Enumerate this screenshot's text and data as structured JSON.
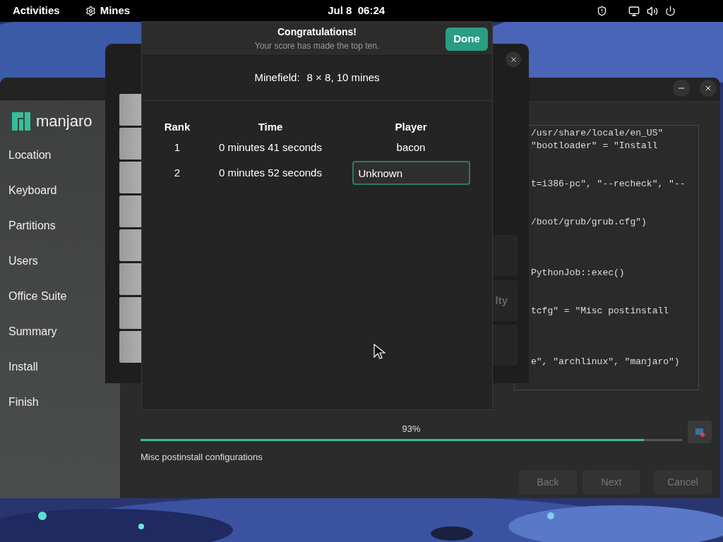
{
  "top_bar": {
    "activities": "Activities",
    "app_name": "Mines",
    "date": "Jul 8",
    "time": "06:24"
  },
  "installer": {
    "logo_text": "manjaro",
    "steps": [
      {
        "label": "Location",
        "selected": false
      },
      {
        "label": "Keyboard",
        "selected": false
      },
      {
        "label": "Partitions",
        "selected": false
      },
      {
        "label": "Users",
        "selected": false
      },
      {
        "label": "Office Suite",
        "selected": false
      },
      {
        "label": "Summary",
        "selected": false
      },
      {
        "label": "Install",
        "selected": false
      },
      {
        "label": "Finish",
        "selected": false
      }
    ],
    "log_lines": [
      "/usr/share/locale/en_US\"",
      "\"bootloader\" = \"Install",
      "t=i386-pc\", \"--recheck\", \"--",
      "/boot/grub/grub.cfg\")",
      "PythonJob::exec()",
      "tcfg\" = \"Misc postinstall",
      "e\", \"archlinux\", \"manjaro\")"
    ],
    "progress": {
      "reading": "93%",
      "level": 0.93
    },
    "status": "Misc postinstall configurations",
    "buttons": [
      {
        "label": "Back",
        "disabled": true
      },
      {
        "label": "Next",
        "disabled": true
      },
      {
        "label": "Cancel",
        "disabled": true
      }
    ]
  },
  "mines_window": {
    "partial_label": "lty"
  },
  "scores_dialog": {
    "title": "Congratulations!",
    "subtitle": "Your score has made the top ten.",
    "done": "Done",
    "minefield_label": "Minefield:",
    "minefield_value": "8 × 8, 10 mines",
    "columns": [
      "Rank",
      "Time",
      "Player"
    ],
    "rows": [
      {
        "rank": "1",
        "time": "0 minutes 41 seconds",
        "player": "bacon",
        "editing": false
      },
      {
        "rank": "2",
        "time": "0 minutes 52 seconds",
        "player": "Unknown",
        "editing": true
      }
    ]
  }
}
